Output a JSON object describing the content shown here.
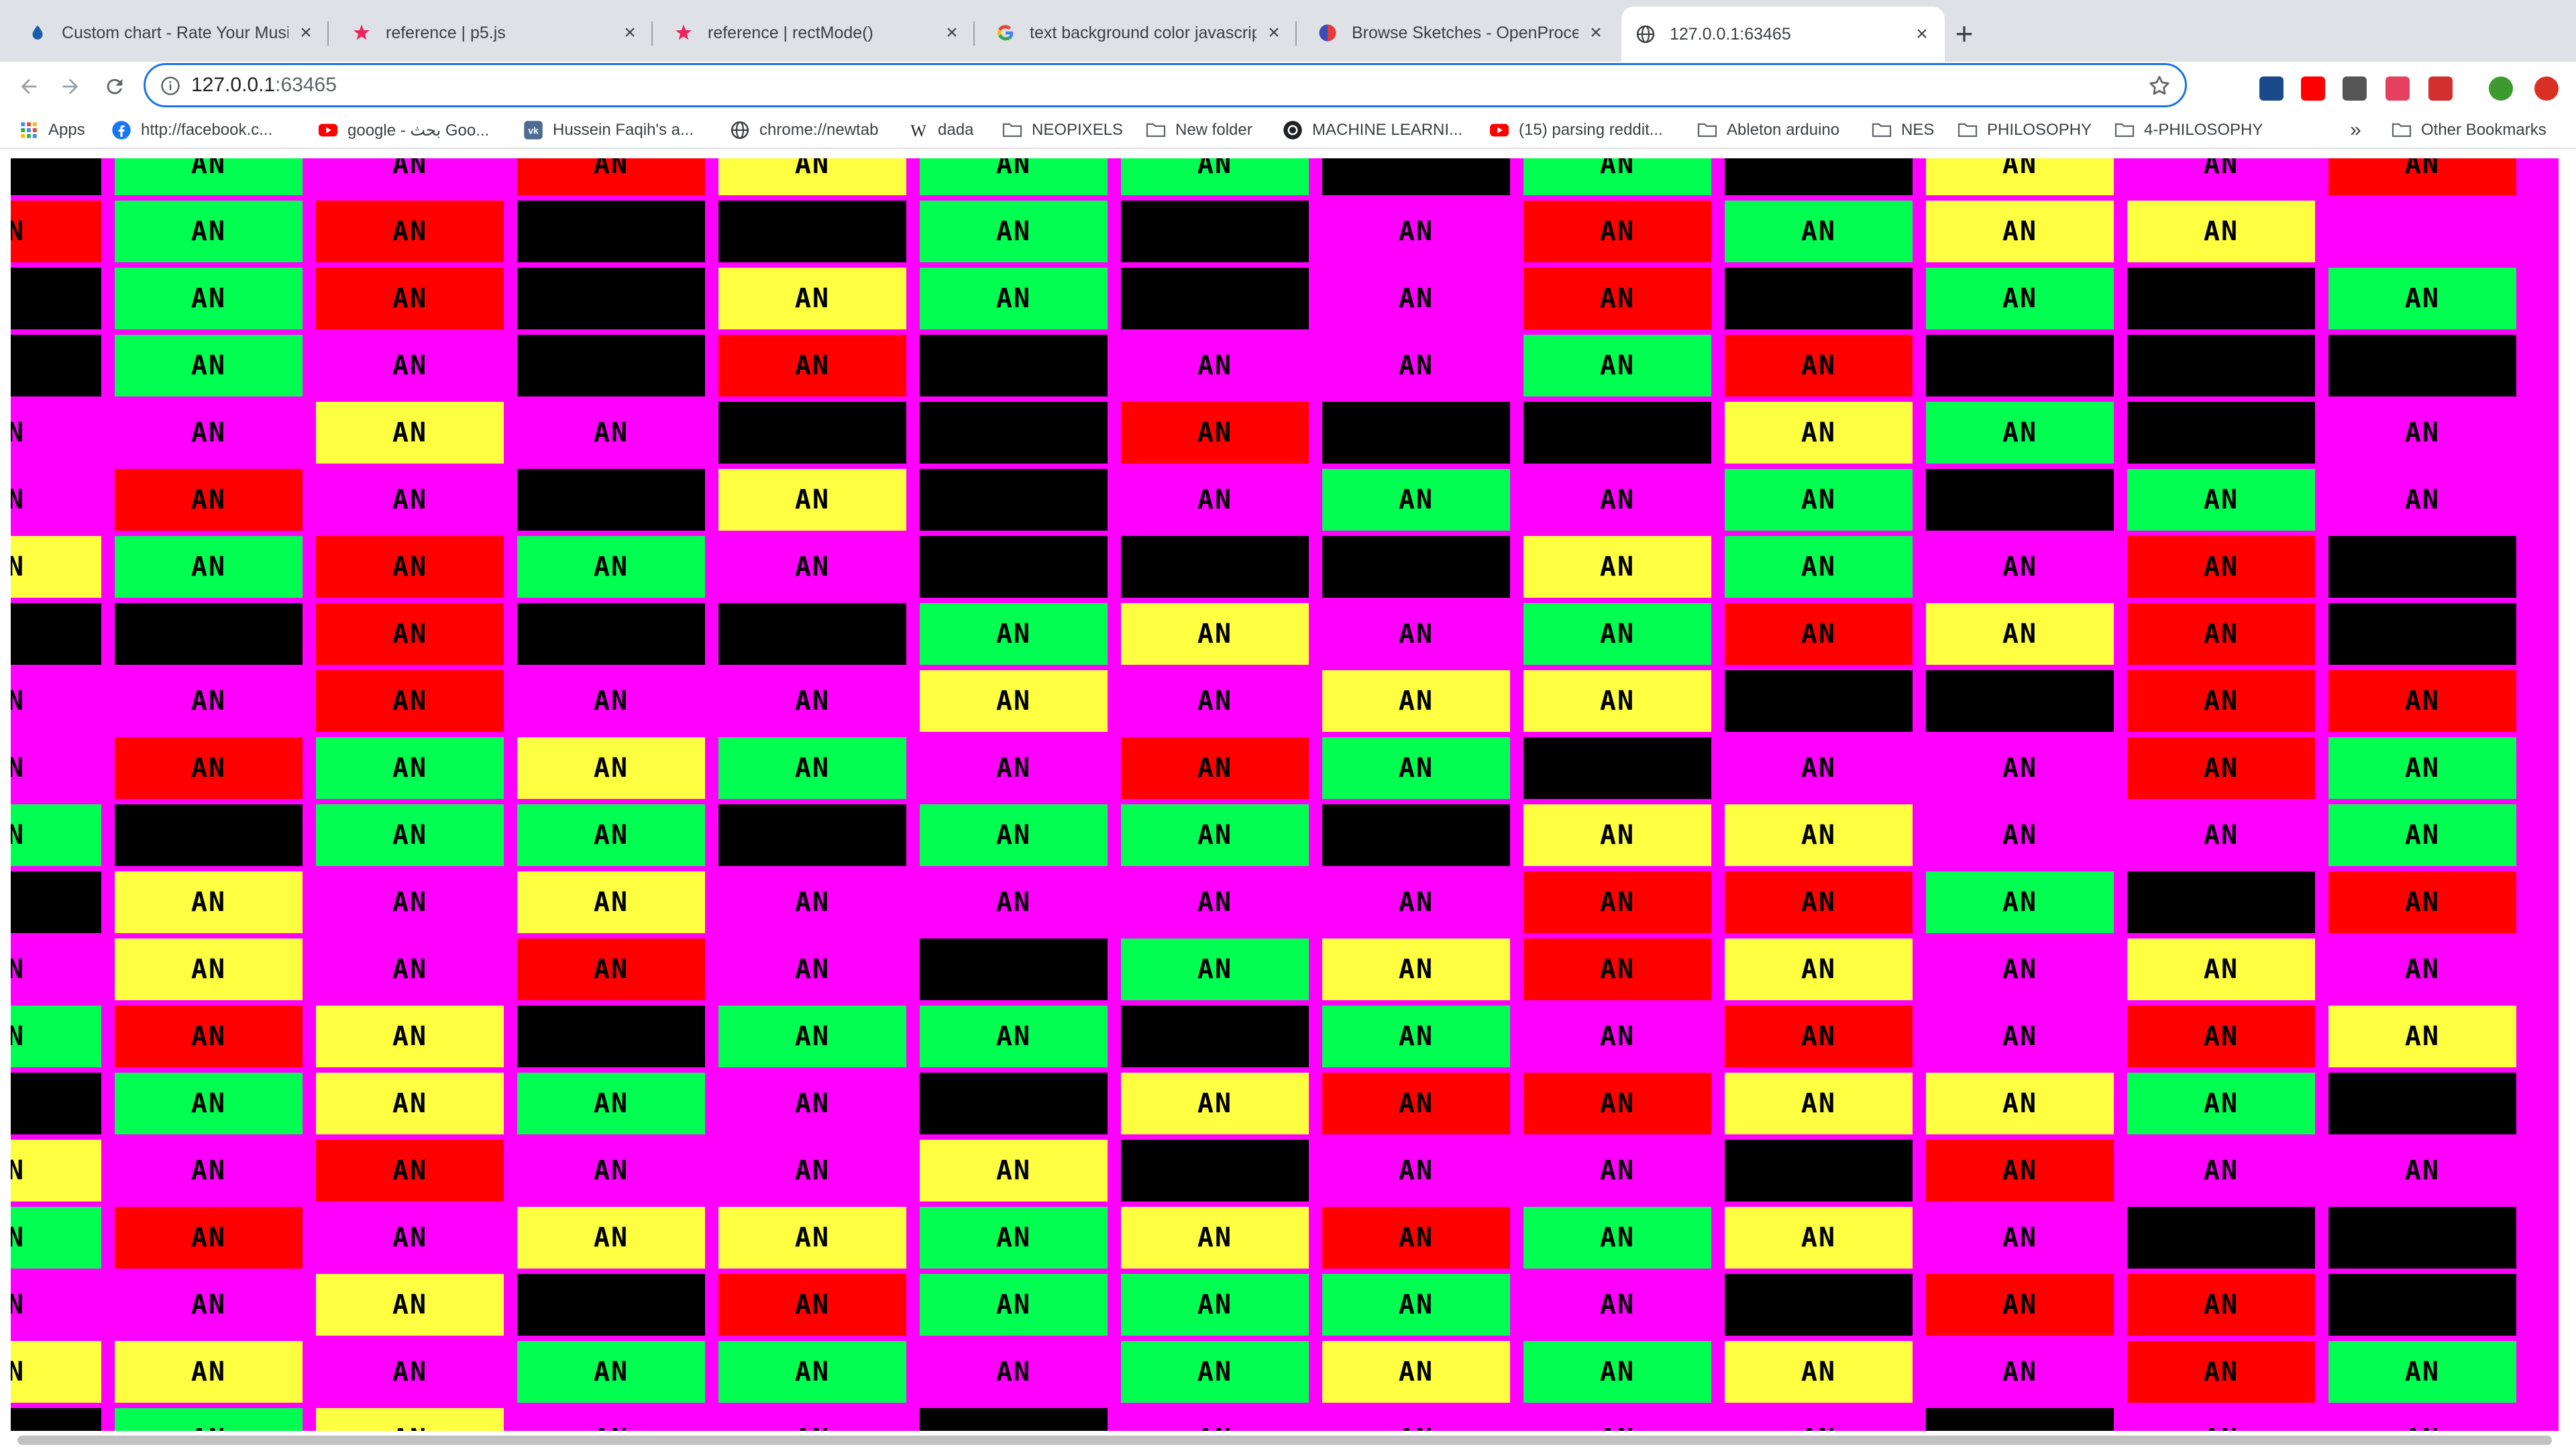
{
  "browser": {
    "tabs": [
      {
        "title": "Custom chart - Rate Your Musi",
        "icon": "rym-icon",
        "active": false
      },
      {
        "title": "reference | p5.js",
        "icon": "p5js-star-icon",
        "active": false
      },
      {
        "title": "reference | rectMode()",
        "icon": "p5js-star-icon",
        "active": false
      },
      {
        "title": "text background color javascrip",
        "icon": "google-icon",
        "active": false
      },
      {
        "title": "Browse Sketches - OpenProce",
        "icon": "openprocessing-icon",
        "active": false
      },
      {
        "title": "127.0.0.1:63465",
        "icon": "globe-icon",
        "active": true
      }
    ],
    "close_glyph": "×",
    "new_tab_glyph": "+",
    "address": {
      "host": "127.0.0.1",
      "port": ":63465"
    },
    "bookmarks": [
      {
        "label": "Apps",
        "icon": "apps-grid-icon"
      },
      {
        "label": "http://facebook.c...",
        "icon": "facebook-icon"
      },
      {
        "label": "google - بحث Goo...",
        "icon": "youtube-icon"
      },
      {
        "label": "Hussein Faqih's a...",
        "icon": "vk-icon"
      },
      {
        "label": "chrome://newtab",
        "icon": "globe-icon"
      },
      {
        "label": "dada",
        "icon": "wikipedia-icon"
      },
      {
        "label": "NEOPIXELS",
        "icon": "folder-icon"
      },
      {
        "label": "New folder",
        "icon": "folder-icon"
      },
      {
        "label": "MACHINE LEARNI...",
        "icon": "openai-icon"
      },
      {
        "label": "(15) parsing reddit...",
        "icon": "youtube-icon"
      },
      {
        "label": "Ableton arduino",
        "icon": "folder-icon"
      },
      {
        "label": "NES",
        "icon": "folder-icon"
      },
      {
        "label": "PHILOSOPHY",
        "icon": "folder-icon"
      },
      {
        "label": "4-PHILOSOPHY",
        "icon": "folder-icon"
      }
    ],
    "bookmarks_overflow": "»",
    "other_bookmarks": "Other Bookmarks",
    "extensions": [
      "chart-extension-icon",
      "youtube-extension-icon",
      "face-extension-icon",
      "instagram-extension-icon",
      "battery-extension-icon",
      "profile-avatar-icon",
      "update-icon"
    ]
  },
  "sketch": {
    "cell_text": "AN",
    "background": "#ff00ff",
    "palette": {
      "r": "#ff0000",
      "g": "#00ff50",
      "y": "#ffff41",
      "k": "#000000",
      "m": "#ff00ff"
    },
    "rows": [
      "kgmryggkgkymr",
      "rgrkkgkmrgyy",
      "kgrkygkmrkgkg",
      "kgmkrkmmgrkkk",
      "mmymkkrkkygkm",
      "mrmkykmgmgkgm",
      "ygrgmkkkygmrk",
      "kkrkkgymgryrk",
      "mmrmmymyykkrr",
      "mrgygmrgkmmrg",
      "gkggkggkyymmg",
      "kymymmmmrrgkr",
      "mymrmkgyrymym",
      "grykggkgmrmry",
      "kgygmkyrryygk",
      "ymrmmykmmkrmm",
      "grmyygyrgymkk",
      "mmykrgggmkrrk",
      "yymggmgygymrg",
      "kgymmkmmmmkmm"
    ]
  }
}
